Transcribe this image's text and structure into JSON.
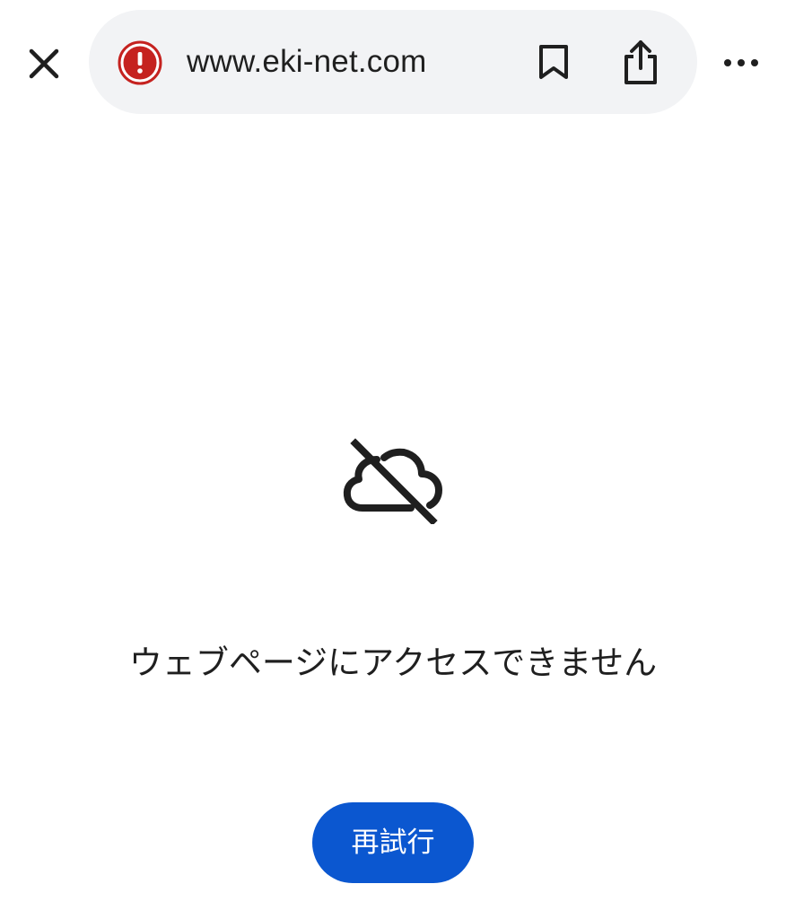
{
  "toolbar": {
    "close_icon": "close-icon",
    "security_icon": "warning-icon",
    "security_color": "#c5221f",
    "url": "www.eki-net.com",
    "bookmark_icon": "bookmark-icon",
    "share_icon": "share-icon",
    "more_icon": "more-horizontal-icon"
  },
  "error_page": {
    "icon": "cloud-off-icon",
    "message": "ウェブページにアクセスできません",
    "retry_label": "再試行",
    "retry_color": "#0b57d0"
  }
}
